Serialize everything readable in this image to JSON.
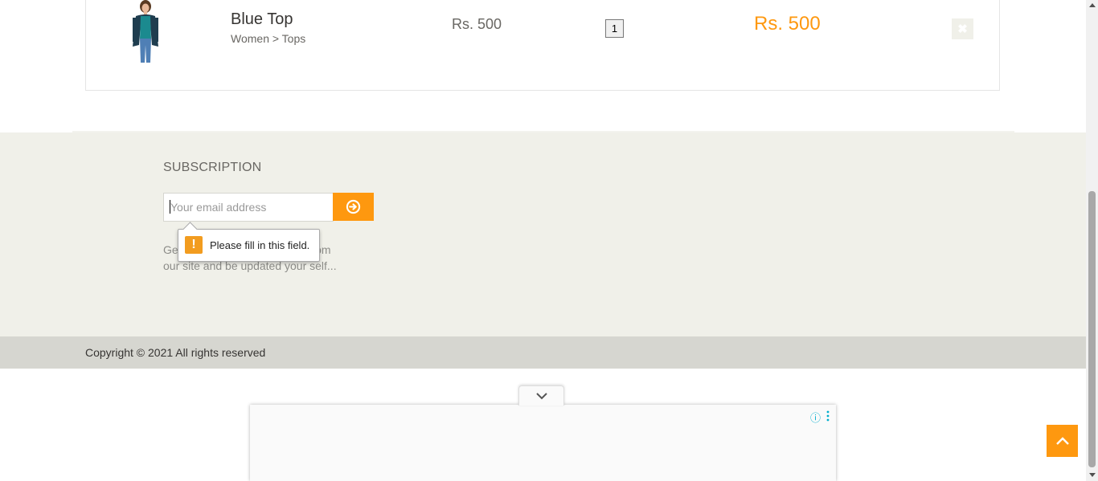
{
  "cart_item": {
    "name": "Blue Top",
    "category": "Women > Tops",
    "price": "Rs. 500",
    "quantity": "1",
    "total": "Rs. 500",
    "delete_icon": "close-icon"
  },
  "subscription": {
    "title": "SUBSCRIPTION",
    "email_placeholder": "Your email address",
    "submit_icon": "arrow-circle-right-icon",
    "description": "Get the most recent updates from our site and be updated your self..."
  },
  "validation_tooltip": {
    "icon": "warning-icon",
    "message": "Please fill in this field."
  },
  "footer": {
    "copyright": "Copyright © 2021 All rights reserved"
  },
  "ad": {
    "collapse_icon": "chevron-down-icon",
    "info_icon": "info-icon",
    "menu_icon": "kebab-menu-icon"
  },
  "scroll_top_icon": "chevron-up-icon",
  "colors": {
    "accent": "#FE980F",
    "footer_bg": "#F0F0E9",
    "footer_bottom_bg": "#D6D6D0"
  }
}
